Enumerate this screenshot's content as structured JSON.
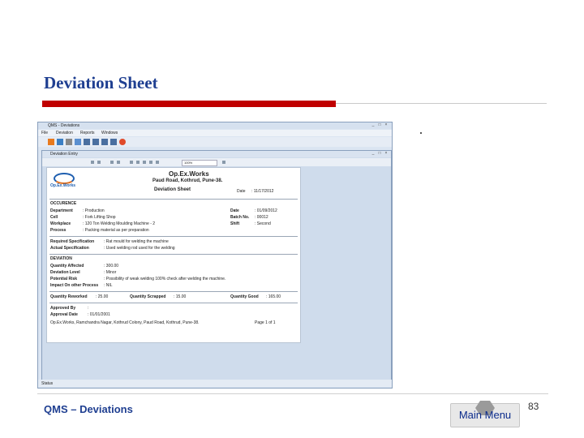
{
  "slide": {
    "title": "Deviation Sheet",
    "footer": "QMS – Deviations",
    "main_menu": "Main Menu",
    "page_number": "83"
  },
  "app": {
    "title": "QMS - Deviations",
    "menu": [
      "File",
      "Deviation",
      "Reports",
      "Windows"
    ],
    "child_title": "Deviation Entry",
    "zoom": "100%",
    "status": "Status"
  },
  "report": {
    "company": "Op.Ex.Works",
    "address": "Paud Road, Kothrud, Pune-38.",
    "doc_title": "Deviation Sheet",
    "date_label": "Date",
    "date_value": ": 11/17/2012",
    "occurence_heading": "OCCURENCE",
    "rows_left": [
      {
        "label": "Department",
        "value": ": Production"
      },
      {
        "label": "Cell",
        "value": ": Fork Lifting Shop"
      },
      {
        "label": "Workplace",
        "value": ": 120 Ton Welding Moulding Machine - 2"
      },
      {
        "label": "Process",
        "value": ": Packing material as per preparation"
      }
    ],
    "rows_right": [
      {
        "label": "Date",
        "value": ": 01/09/2012"
      },
      {
        "label": "Batch No.",
        "value": ": 00012"
      },
      {
        "label": "Shift",
        "value": ": Second"
      }
    ],
    "required_spec_label": "Required Specification",
    "required_spec_value": ": Rat mould for welding the machine",
    "actual_spec_label": "Actual Specification",
    "actual_spec_value": ": Used welding rod used for the welding",
    "deviation_heading": "DEVIATION",
    "deviation_rows": [
      {
        "label": "Quantity Affected",
        "value": ": 300.00"
      },
      {
        "label": "Deviation Level",
        "value": ": Minor"
      },
      {
        "label": "Potential Risk",
        "value": ": Possibility of weak welding 100% check after welding the machine."
      },
      {
        "label": "Impact On other Process",
        "value": ": NIL"
      }
    ],
    "qty_reworked_label": "Quantity Reworked",
    "qty_reworked_value": ": 25.00",
    "qty_scrapped_label": "Quantity Scrapped",
    "qty_scrapped_value": ": 15.00",
    "qty_good_label": "Quantity Good",
    "qty_good_value": ": 165.00",
    "approved_by_label": "Approved By",
    "approved_by_value": ":",
    "approval_date_label": "Approval Date",
    "approval_date_value": ": 01/01/2001",
    "footer_address": "Op.Ex.Works, Ramchandra Nagar, Kothrud Colony, Paud Road, Kothrud, Pune-38.",
    "page_of": "Page 1 of 1"
  },
  "colors": {
    "title_blue": "#1f3f91",
    "accent_red": "#c00000"
  }
}
